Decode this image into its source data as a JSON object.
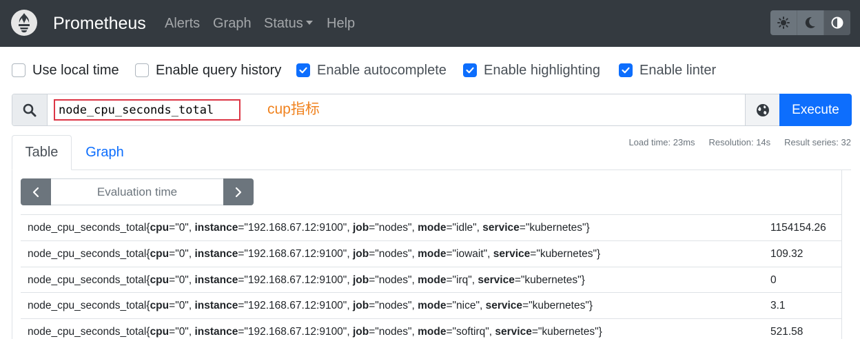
{
  "navbar": {
    "brand": "Prometheus",
    "links": [
      "Alerts",
      "Graph",
      "Status",
      "Help"
    ]
  },
  "options": [
    {
      "label": "Use local time",
      "checked": false
    },
    {
      "label": "Enable query history",
      "checked": false
    },
    {
      "label": "Enable autocomplete",
      "checked": true
    },
    {
      "label": "Enable highlighting",
      "checked": true
    },
    {
      "label": "Enable linter",
      "checked": true
    }
  ],
  "query": {
    "expression": "node_cpu_seconds_total",
    "annotation": "cup指标",
    "execute_label": "Execute"
  },
  "stats": {
    "load_time": "Load time: 23ms",
    "resolution": "Resolution: 14s",
    "result_series": "Result series: 32"
  },
  "tabs": {
    "table": "Table",
    "graph": "Graph"
  },
  "eval_time_placeholder": "Evaluation time",
  "colors": {
    "navbar": "#343a40",
    "accent": "#0d6efd",
    "highlight_box": "#dc3545",
    "annotation": "#f0821e"
  },
  "rows": [
    {
      "metric": "node_cpu_seconds_total",
      "cpu": "\"0\"",
      "instance": "\"192.168.67.12:9100\"",
      "job": "\"nodes\"",
      "mode": "\"idle\"",
      "service": "\"kubernetes\"",
      "value": "1154154.26"
    },
    {
      "metric": "node_cpu_seconds_total",
      "cpu": "\"0\"",
      "instance": "\"192.168.67.12:9100\"",
      "job": "\"nodes\"",
      "mode": "\"iowait\"",
      "service": "\"kubernetes\"",
      "value": "109.32"
    },
    {
      "metric": "node_cpu_seconds_total",
      "cpu": "\"0\"",
      "instance": "\"192.168.67.12:9100\"",
      "job": "\"nodes\"",
      "mode": "\"irq\"",
      "service": "\"kubernetes\"",
      "value": "0"
    },
    {
      "metric": "node_cpu_seconds_total",
      "cpu": "\"0\"",
      "instance": "\"192.168.67.12:9100\"",
      "job": "\"nodes\"",
      "mode": "\"nice\"",
      "service": "\"kubernetes\"",
      "value": "3.1"
    },
    {
      "metric": "node_cpu_seconds_total",
      "cpu": "\"0\"",
      "instance": "\"192.168.67.12:9100\"",
      "job": "\"nodes\"",
      "mode": "\"softirq\"",
      "service": "\"kubernetes\"",
      "value": "521.58"
    }
  ]
}
